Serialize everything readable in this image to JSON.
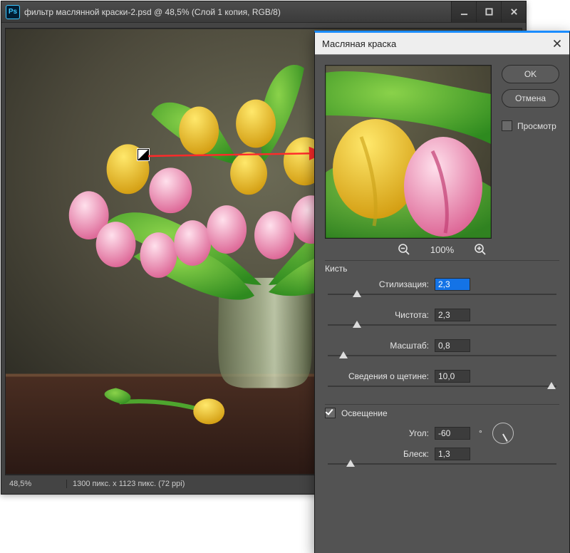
{
  "ps_window": {
    "title": "фильтр маслянной краски-2.psd @ 48,5% (Слой 1 копия, RGB/8)",
    "status_zoom": "48,5%",
    "status_dims": "1300 пикс. x 1123 пикс. (72 ppi)"
  },
  "dialog": {
    "title": "Масляная краска",
    "buttons": {
      "ok": "OK",
      "cancel": "Отмена"
    },
    "preview_checkbox": {
      "label": "Просмотр",
      "checked": false
    },
    "zoom": {
      "value": "100%"
    },
    "brush": {
      "title": "Кисть",
      "stylization": {
        "label": "Стилизация:",
        "value": "2,3",
        "pos_pct": 13
      },
      "cleanliness": {
        "label": "Чистота:",
        "value": "2,3",
        "pos_pct": 13
      },
      "scale": {
        "label": "Масштаб:",
        "value": "0,8",
        "pos_pct": 7
      },
      "bristle": {
        "label": "Сведения о щетине:",
        "value": "10,0",
        "pos_pct": 98
      }
    },
    "lighting": {
      "title": "Освещение",
      "checked": true,
      "angle": {
        "label": "Угол:",
        "value": "-60",
        "deg_rot": -60
      },
      "shine": {
        "label": "Блеск:",
        "value": "1,3",
        "pos_pct": 10
      }
    }
  }
}
